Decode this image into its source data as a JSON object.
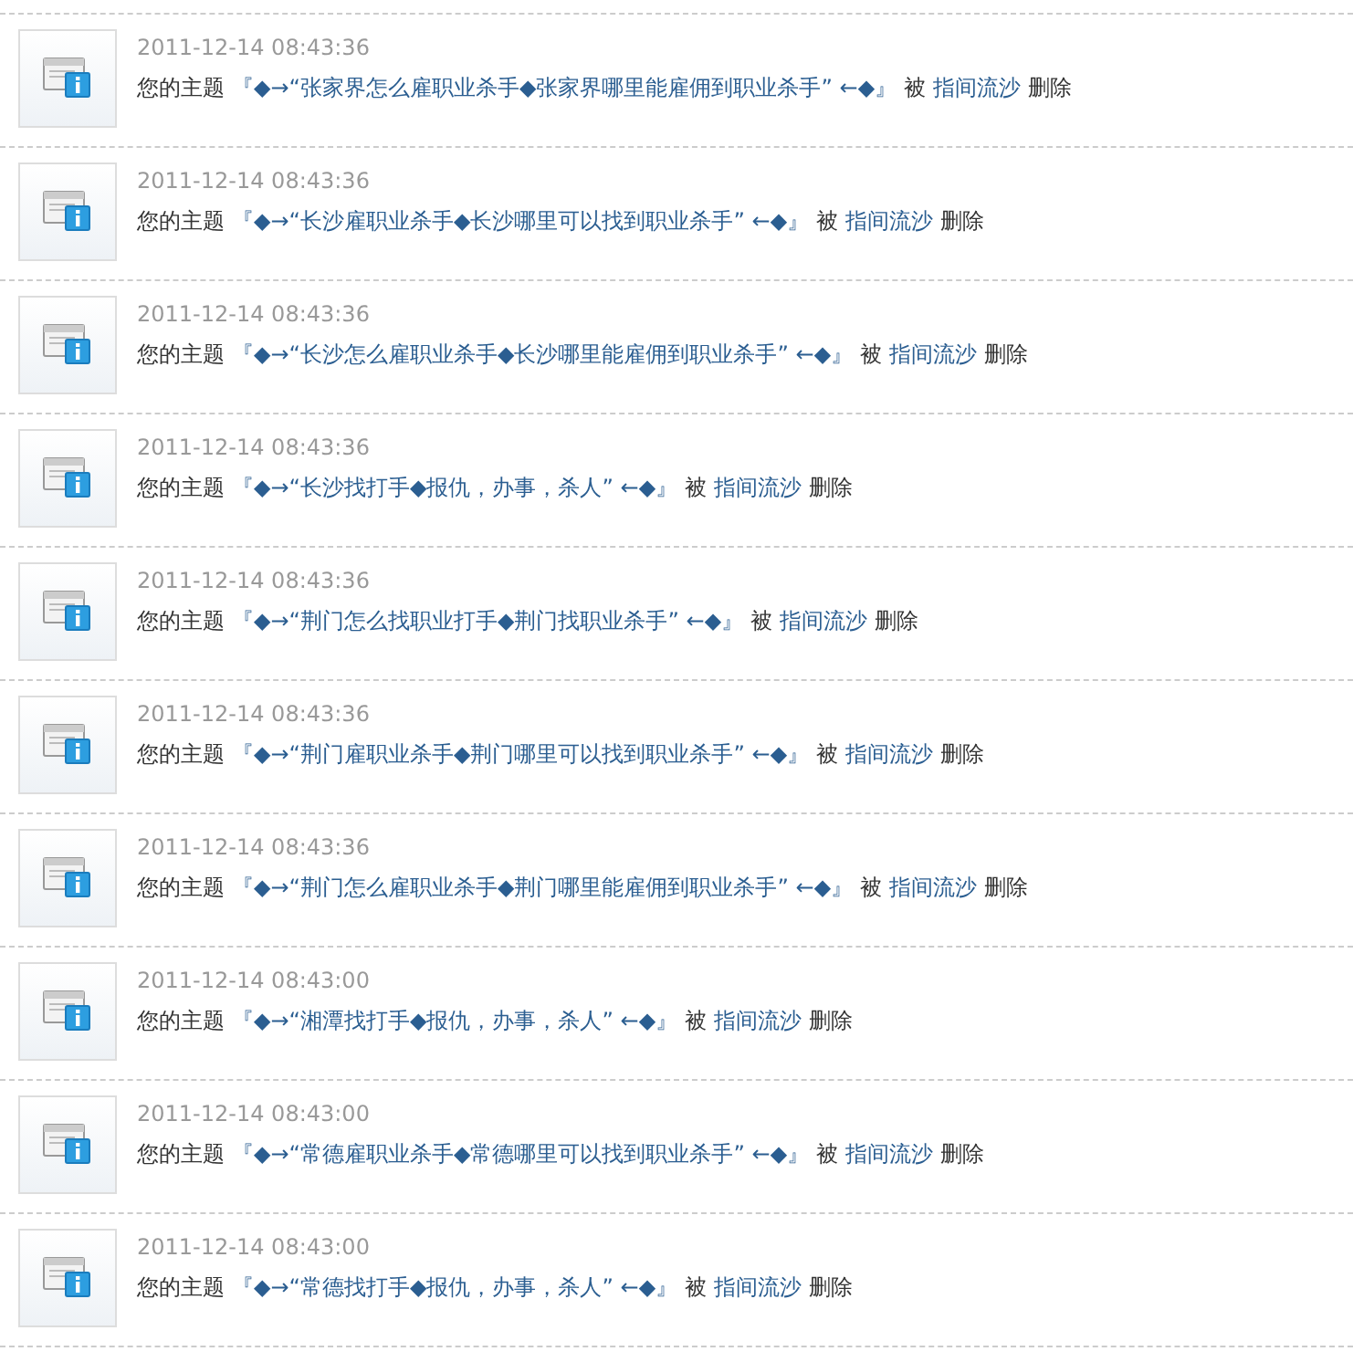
{
  "notices": [
    {
      "time": "2011-12-14 08:43:36",
      "prefix": "您的主题",
      "title": "『◆→“张家界怎么雇职业杀手◆张家界哪里能雇佣到职业杀手” ←◆』",
      "by": "被",
      "user": "指间流沙",
      "action": "删除"
    },
    {
      "time": "2011-12-14 08:43:36",
      "prefix": "您的主题",
      "title": "『◆→“长沙雇职业杀手◆长沙哪里可以找到职业杀手” ←◆』",
      "by": "被",
      "user": "指间流沙",
      "action": "删除"
    },
    {
      "time": "2011-12-14 08:43:36",
      "prefix": "您的主题",
      "title": "『◆→“长沙怎么雇职业杀手◆长沙哪里能雇佣到职业杀手” ←◆』",
      "by": "被",
      "user": "指间流沙",
      "action": "删除"
    },
    {
      "time": "2011-12-14 08:43:36",
      "prefix": "您的主题",
      "title": "『◆→“长沙找打手◆报仇，办事，杀人” ←◆』",
      "by": "被",
      "user": "指间流沙",
      "action": "删除"
    },
    {
      "time": "2011-12-14 08:43:36",
      "prefix": "您的主题",
      "title": "『◆→“荆门怎么找职业打手◆荆门找职业杀手” ←◆』",
      "by": "被",
      "user": "指间流沙",
      "action": "删除"
    },
    {
      "time": "2011-12-14 08:43:36",
      "prefix": "您的主题",
      "title": "『◆→“荆门雇职业杀手◆荆门哪里可以找到职业杀手” ←◆』",
      "by": "被",
      "user": "指间流沙",
      "action": "删除"
    },
    {
      "time": "2011-12-14 08:43:36",
      "prefix": "您的主题",
      "title": "『◆→“荆门怎么雇职业杀手◆荆门哪里能雇佣到职业杀手” ←◆』",
      "by": "被",
      "user": "指间流沙",
      "action": "删除"
    },
    {
      "time": "2011-12-14 08:43:00",
      "prefix": "您的主题",
      "title": "『◆→“湘潭找打手◆报仇，办事，杀人” ←◆』",
      "by": "被",
      "user": "指间流沙",
      "action": "删除"
    },
    {
      "time": "2011-12-14 08:43:00",
      "prefix": "您的主题",
      "title": "『◆→“常德雇职业杀手◆常德哪里可以找到职业杀手” ←◆』",
      "by": "被",
      "user": "指间流沙",
      "action": "删除"
    },
    {
      "time": "2011-12-14 08:43:00",
      "prefix": "您的主题",
      "title": "『◆→“常德找打手◆报仇，办事，杀人” ←◆』",
      "by": "被",
      "user": "指间流沙",
      "action": "删除"
    }
  ]
}
